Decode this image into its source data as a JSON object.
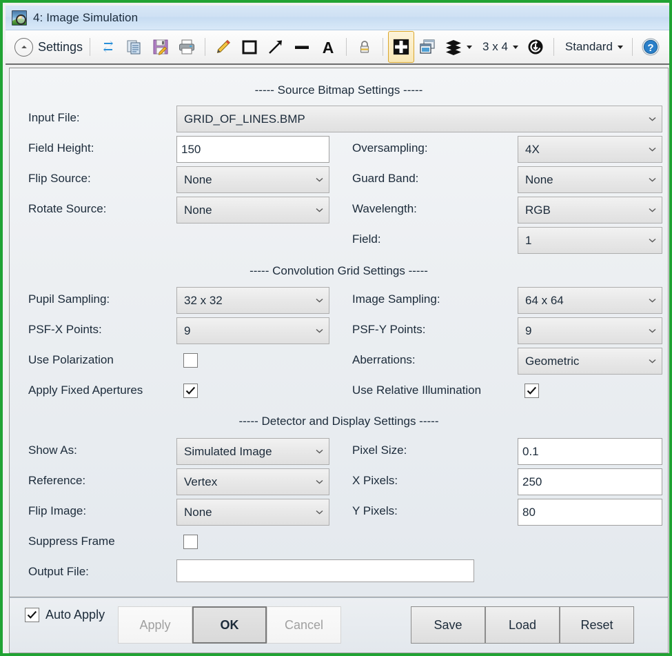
{
  "window": {
    "title": "4: Image Simulation",
    "icon": "image-magnifier-icon",
    "border_color": "#21a333"
  },
  "toolbar": {
    "settings_label": "Settings",
    "settings_icon": "chevron-up-circle-icon",
    "icons": [
      {
        "name": "refresh-icon",
        "label": ""
      },
      {
        "name": "copy-icon",
        "label": ""
      },
      {
        "name": "save-icon",
        "label": ""
      },
      {
        "name": "print-icon",
        "label": ""
      },
      {
        "name": "pencil-annotation-icon",
        "label": ""
      },
      {
        "name": "rectangle-annotation-icon",
        "label": ""
      },
      {
        "name": "arrow-annotation-icon",
        "label": ""
      },
      {
        "name": "line-annotation-icon",
        "label": ""
      },
      {
        "name": "text-annotation-icon",
        "label": ""
      },
      {
        "name": "lock-icon",
        "label": ""
      },
      {
        "name": "fit-window-icon",
        "label": ""
      },
      {
        "name": "detach-window-icon",
        "label": ""
      },
      {
        "name": "layers-icon",
        "label": ""
      }
    ],
    "grid_label": "3 x 4",
    "refresh_all_icon": "clockwise-refresh-icon",
    "style_label": "Standard",
    "help_icon": "help-icon"
  },
  "sections": {
    "source": {
      "heading": "----- Source Bitmap Settings -----",
      "fields": {
        "input_file_label": "Input File:",
        "input_file_value": "GRID_OF_LINES.BMP",
        "field_height_label": "Field Height:",
        "field_height_value": "150",
        "flip_source_label": "Flip Source:",
        "flip_source_value": "None",
        "rotate_source_label": "Rotate Source:",
        "rotate_source_value": "None",
        "oversampling_label": "Oversampling:",
        "oversampling_value": "4X",
        "guard_band_label": "Guard Band:",
        "guard_band_value": "None",
        "wavelength_label": "Wavelength:",
        "wavelength_value": "RGB",
        "field_label": "Field:",
        "field_value": "1"
      }
    },
    "convolution": {
      "heading": "----- Convolution Grid Settings -----",
      "fields": {
        "pupil_sampling_label": "Pupil Sampling:",
        "pupil_sampling_value": "32 x 32",
        "psf_x_label": "PSF-X Points:",
        "psf_x_value": "9",
        "use_polarization_label": "Use Polarization",
        "use_polarization_checked": false,
        "apply_fixed_apertures_label": "Apply Fixed Apertures",
        "apply_fixed_apertures_checked": true,
        "image_sampling_label": "Image Sampling:",
        "image_sampling_value": "64 x 64",
        "psf_y_label": "PSF-Y Points:",
        "psf_y_value": "9",
        "aberrations_label": "Aberrations:",
        "aberrations_value": "Geometric",
        "use_relative_illumination_label": "Use Relative Illumination",
        "use_relative_illumination_checked": true
      }
    },
    "detector": {
      "heading": "----- Detector and Display Settings -----",
      "fields": {
        "show_as_label": "Show As:",
        "show_as_value": "Simulated Image",
        "reference_label": "Reference:",
        "reference_value": "Vertex",
        "flip_image_label": "Flip Image:",
        "flip_image_value": "None",
        "suppress_frame_label": "Suppress Frame",
        "suppress_frame_checked": false,
        "output_file_label": "Output File:",
        "output_file_value": "",
        "pixel_size_label": "Pixel Size:",
        "pixel_size_value": "0.1",
        "x_pixels_label": "X Pixels:",
        "x_pixels_value": "250",
        "y_pixels_label": "Y Pixels:",
        "y_pixels_value": "80"
      }
    }
  },
  "footer": {
    "auto_apply_label": "Auto Apply",
    "auto_apply_checked": true,
    "apply_label": "Apply",
    "apply_disabled": true,
    "ok_label": "OK",
    "cancel_label": "Cancel",
    "cancel_disabled": true,
    "save_label": "Save",
    "load_label": "Load",
    "reset_label": "Reset"
  }
}
